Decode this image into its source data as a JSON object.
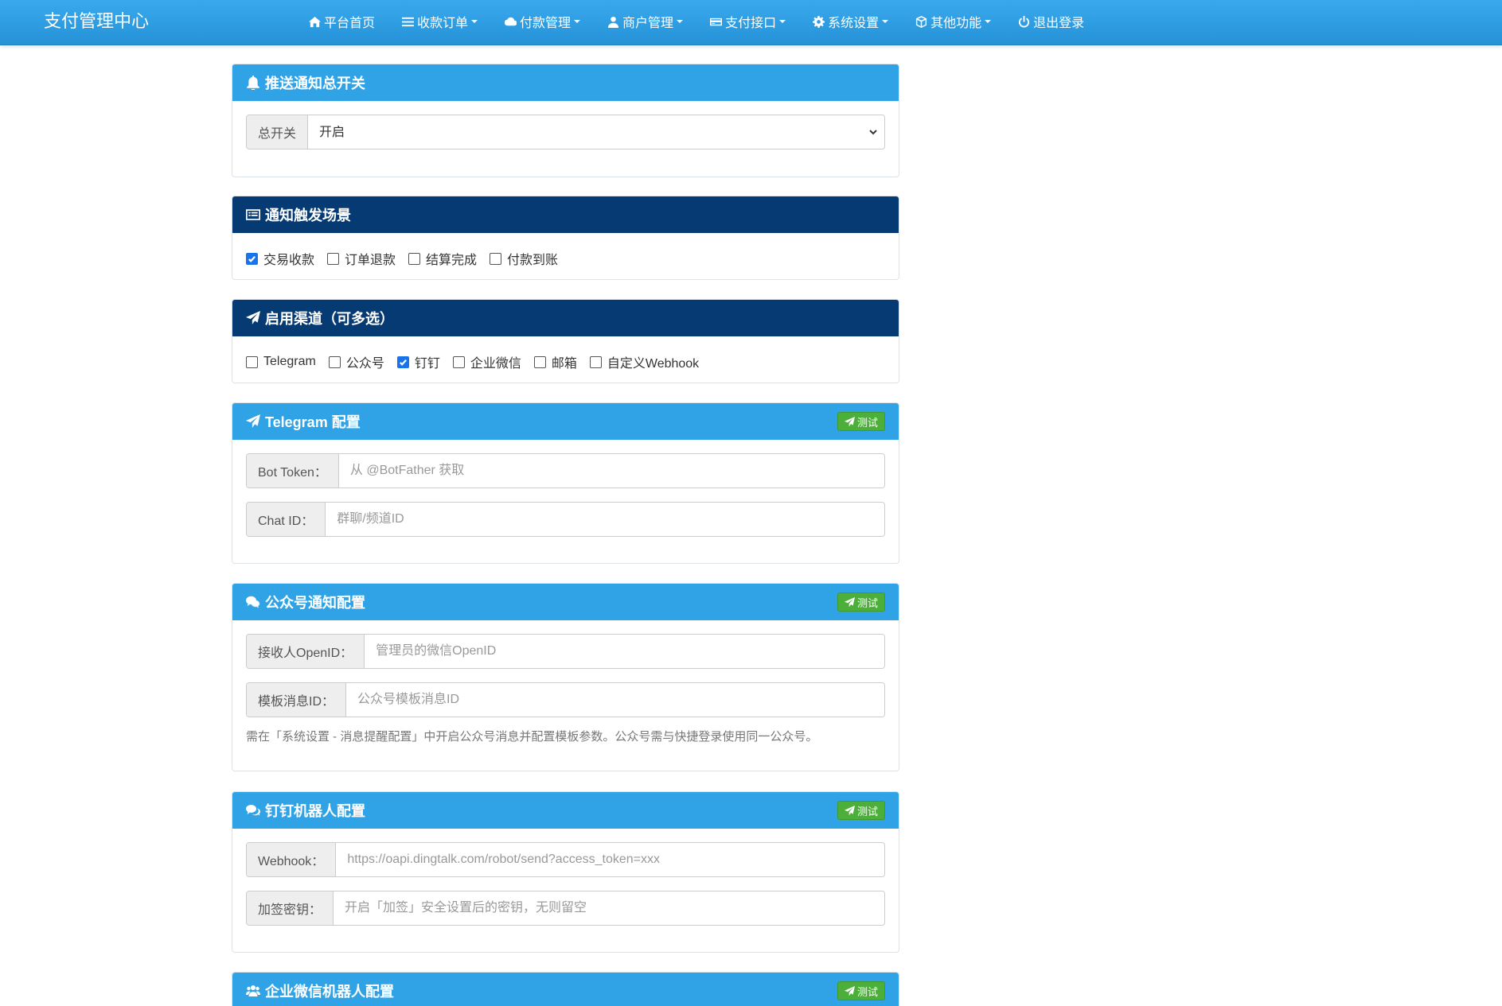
{
  "nav": {
    "brand": "支付管理中心",
    "items": [
      {
        "label": "平台首页",
        "icon": "home-icon",
        "dropdown": false
      },
      {
        "label": "收款订单",
        "icon": "list-icon",
        "dropdown": true
      },
      {
        "label": "付款管理",
        "icon": "cloud-icon",
        "dropdown": true
      },
      {
        "label": "商户管理",
        "icon": "user-icon",
        "dropdown": true
      },
      {
        "label": "支付接口",
        "icon": "credit-card-icon",
        "dropdown": true
      },
      {
        "label": "系统设置",
        "icon": "gear-icon",
        "dropdown": true
      },
      {
        "label": "其他功能",
        "icon": "cube-icon",
        "dropdown": true
      },
      {
        "label": "退出登录",
        "icon": "power-icon",
        "dropdown": false
      }
    ]
  },
  "master_switch": {
    "title": "推送通知总开关",
    "label": "总开关",
    "value": "开启"
  },
  "triggers": {
    "title": "通知触发场景",
    "options": [
      {
        "label": "交易收款",
        "checked": true
      },
      {
        "label": "订单退款",
        "checked": false
      },
      {
        "label": "结算完成",
        "checked": false
      },
      {
        "label": "付款到账",
        "checked": false
      }
    ]
  },
  "channels": {
    "title": "启用渠道（可多选）",
    "options": [
      {
        "label": "Telegram",
        "checked": false
      },
      {
        "label": "公众号",
        "checked": false
      },
      {
        "label": "钉钉",
        "checked": true
      },
      {
        "label": "企业微信",
        "checked": false
      },
      {
        "label": "邮箱",
        "checked": false
      },
      {
        "label": "自定义Webhook",
        "checked": false
      }
    ]
  },
  "telegram": {
    "title": "Telegram 配置",
    "test": "测试",
    "bot_token_label": "Bot Token：",
    "bot_token_placeholder": "从 @BotFather 获取",
    "chat_id_label": "Chat ID：",
    "chat_id_placeholder": "群聊/频道ID"
  },
  "wechat": {
    "title": "公众号通知配置",
    "test": "测试",
    "openid_label": "接收人OpenID：",
    "openid_placeholder": "管理员的微信OpenID",
    "template_label": "模板消息ID：",
    "template_placeholder": "公众号模板消息ID",
    "help": "需在「系统设置 - 消息提醒配置」中开启公众号消息并配置模板参数。公众号需与快捷登录使用同一公众号。"
  },
  "dingtalk": {
    "title": "钉钉机器人配置",
    "test": "测试",
    "webhook_label": "Webhook：",
    "webhook_placeholder": "https://oapi.dingtalk.com/robot/send?access_token=xxx",
    "secret_label": "加签密钥：",
    "secret_placeholder": "开启「加签」安全设置后的密钥，无则留空"
  },
  "wework": {
    "title": "企业微信机器人配置",
    "test": "测试"
  },
  "colors": {
    "nav": "#2592d8",
    "panel_light": "#2fa3e6",
    "panel_dark": "#063a72",
    "test_button": "#4caf3a"
  }
}
